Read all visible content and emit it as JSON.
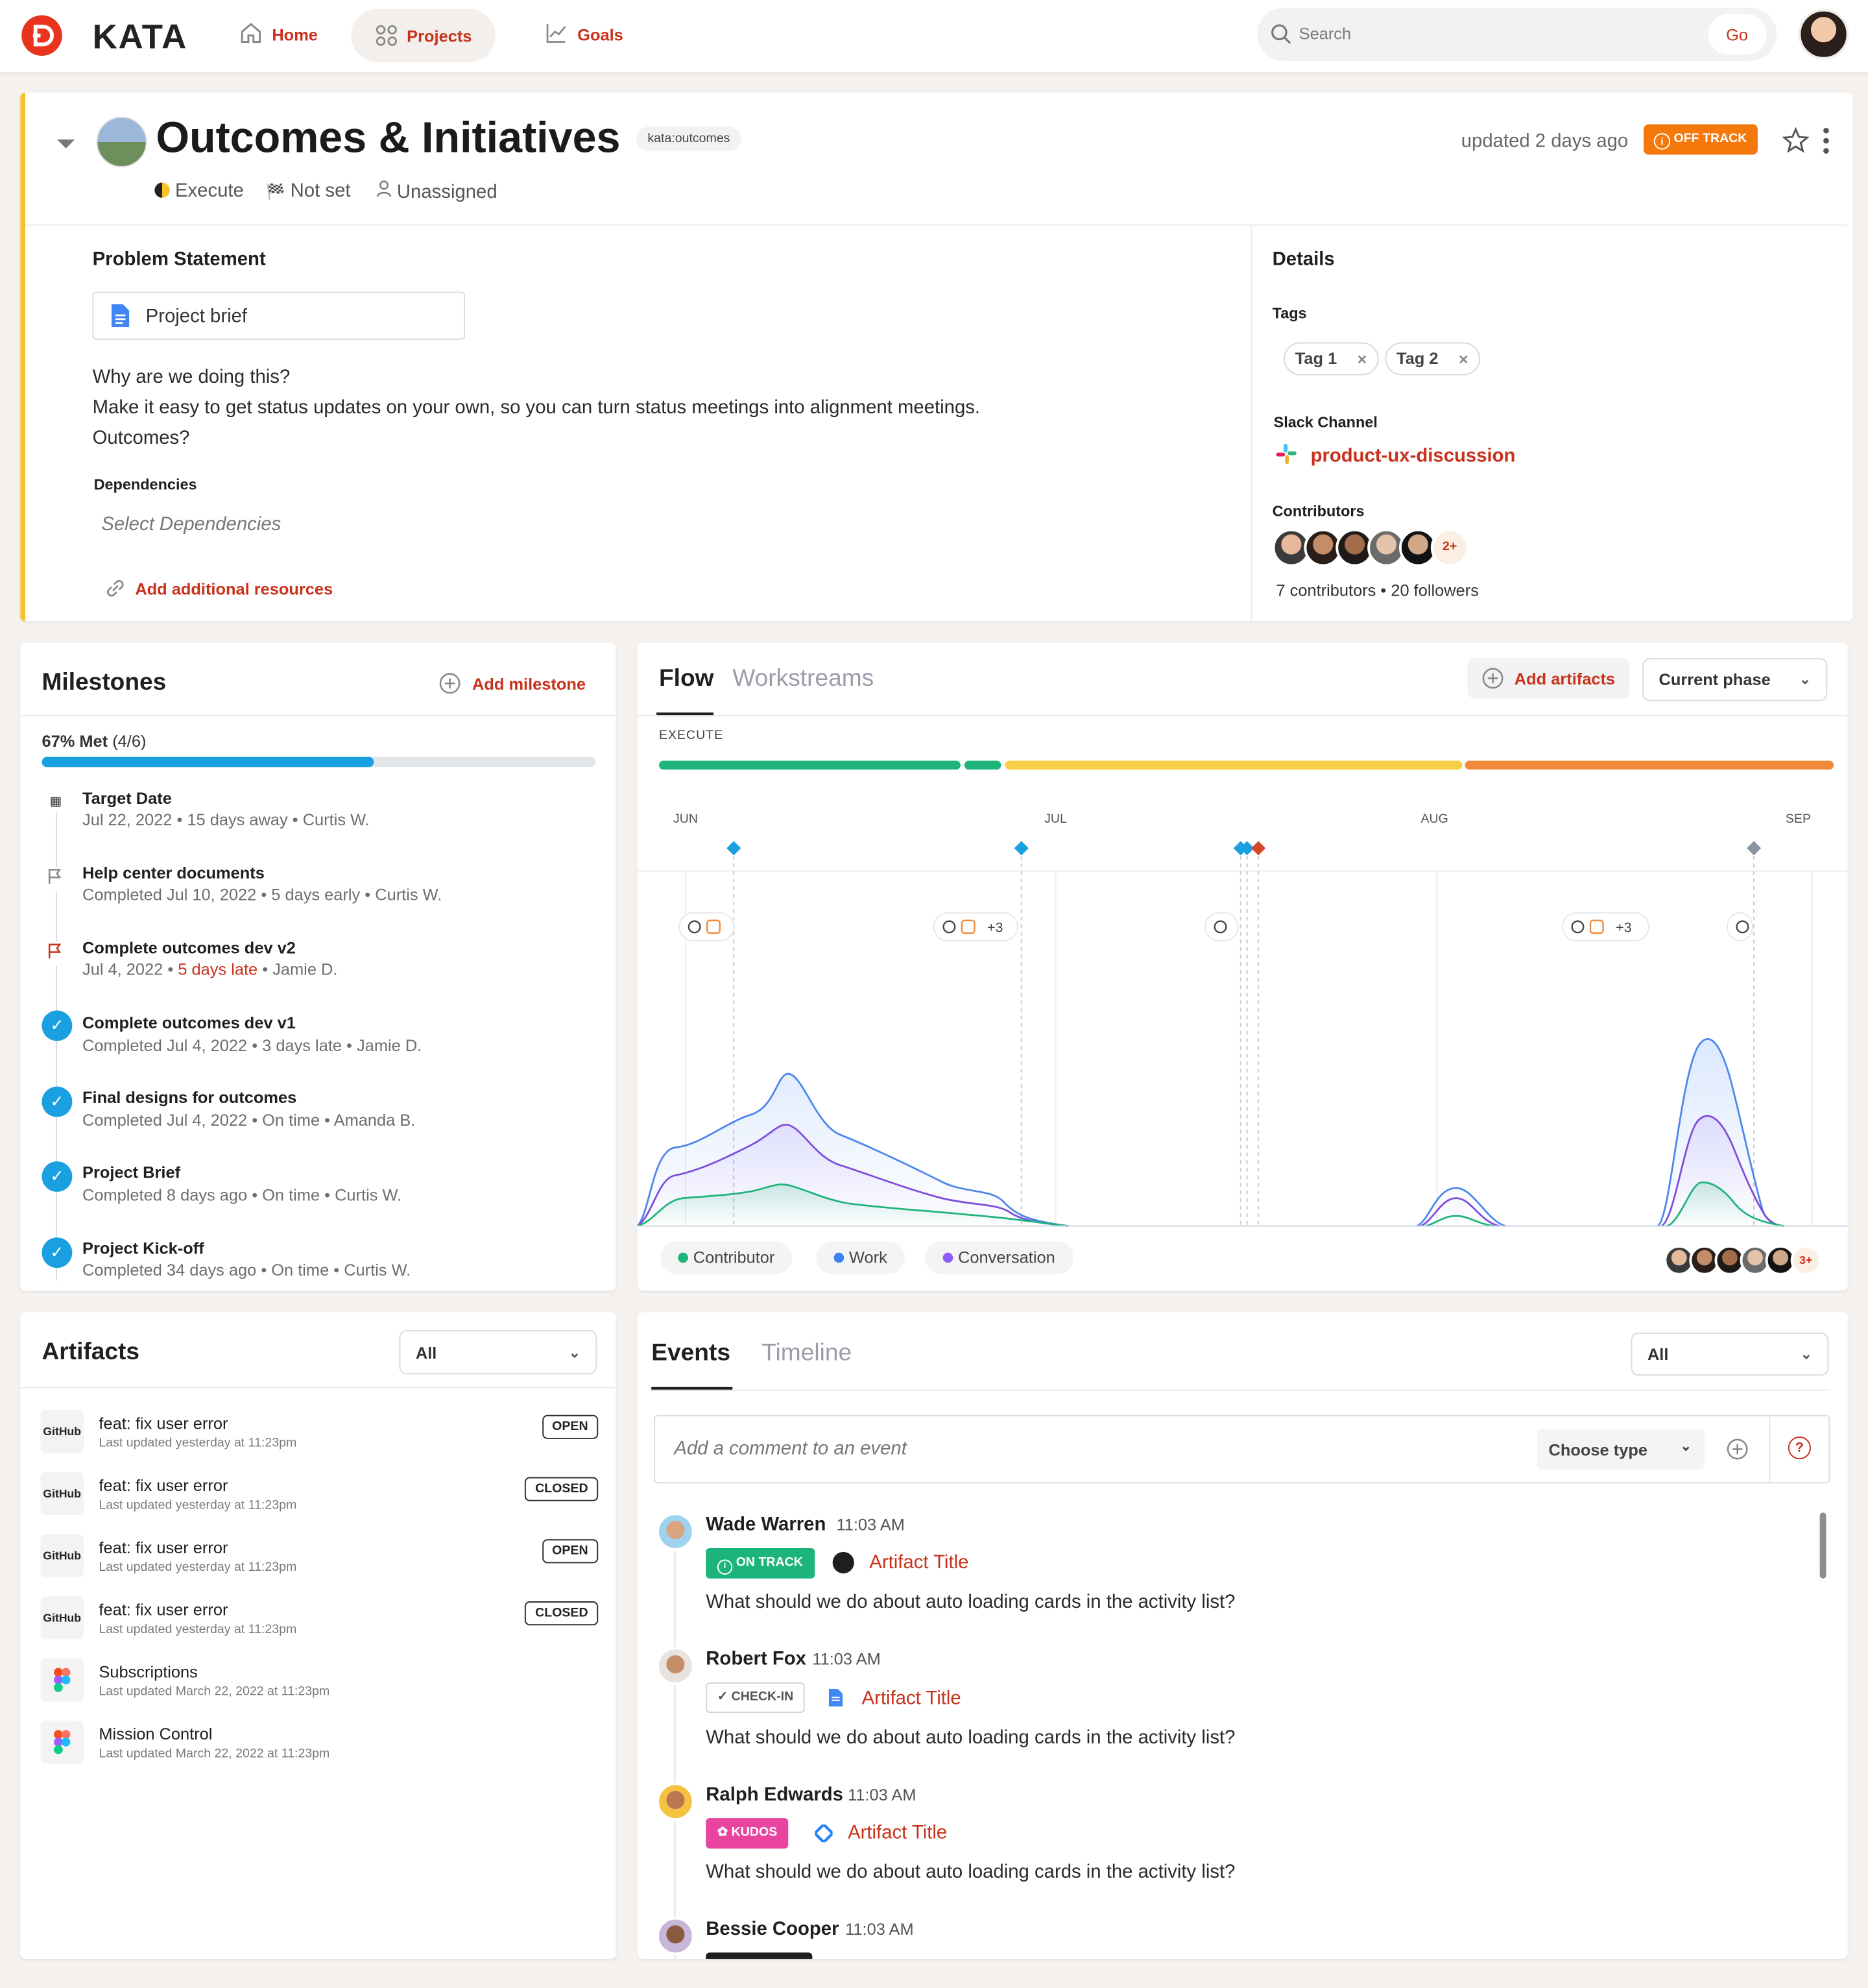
{
  "nav": {
    "brand": "KATA",
    "items": [
      {
        "label": "Home"
      },
      {
        "label": "Projects"
      },
      {
        "label": "Goals"
      }
    ],
    "search_placeholder": "Search",
    "go_label": "Go"
  },
  "project": {
    "title": "Outcomes & Initiatives",
    "tag": "kata:outcomes",
    "phase": "Execute",
    "target": "Not set",
    "owner": "Unassigned",
    "updated": "updated 2 days ago",
    "status": "OFF TRACK",
    "status_color": "#f5780b"
  },
  "problem": {
    "heading": "Problem Statement",
    "brief_label": "Project brief",
    "line1": "Why are we doing this?",
    "line2": "Make it easy to get status updates on your own, so you can turn status meetings into alignment meetings.",
    "line3": "Outcomes?",
    "dependencies_heading": "Dependencies",
    "dependencies_placeholder": "Select Dependencies",
    "add_resources": "Add additional resources"
  },
  "details": {
    "heading": "Details",
    "tags_heading": "Tags",
    "tags": [
      "Tag 1",
      "Tag 2"
    ],
    "slack_heading": "Slack Channel",
    "slack_channel": "product-ux-discussion",
    "contributors_heading": "Contributors",
    "contributors_more": "2+",
    "contributors_summary": "7 contributors • 20 followers"
  },
  "milestones": {
    "heading": "Milestones",
    "add_label": "Add milestone",
    "met_label": "67% Met",
    "met_count": "(4/6)",
    "progress": 0.6,
    "items": [
      {
        "title": "Target Date",
        "sub": "Jul 22, 2022 • 15 days away • Curtis W.",
        "icon": "checkered-flag-icon"
      },
      {
        "title": "Help center documents",
        "sub": "Completed Jul 10, 2022 • 5 days early • Curtis W.",
        "icon": "flag-icon"
      },
      {
        "title": "Complete outcomes dev v2",
        "sub_a": "Jul 4, 2022 •",
        "sub_late": "5 days late",
        "sub_b": "• Jamie D.",
        "icon": "red-flag-icon"
      },
      {
        "title": "Complete outcomes dev v1",
        "sub": "Completed Jul 4, 2022 • 3 days late • Jamie D.",
        "icon": "check-icon"
      },
      {
        "title": "Final designs for outcomes",
        "sub": "Completed Jul 4, 2022 • On time • Amanda B.",
        "icon": "check-icon"
      },
      {
        "title": "Project Brief",
        "sub": "Completed 8 days ago • On time • Curtis W.",
        "icon": "check-icon"
      },
      {
        "title": "Project Kick-off",
        "sub": "Completed 34 days ago • On time • Curtis W.",
        "icon": "check-icon"
      }
    ]
  },
  "flow": {
    "tabs": [
      "Flow",
      "Workstreams"
    ],
    "add_artifacts": "Add artifacts",
    "phase_select": "Current phase",
    "phase_label": "EXECUTE",
    "months": [
      "JUN",
      "JUL",
      "AUG",
      "SEP"
    ],
    "marker_more": "+3",
    "legend": [
      "Contributor",
      "Work",
      "Conversation"
    ],
    "legend_colors": [
      "#1fb47a",
      "#3b82f6",
      "#8b5cf6"
    ],
    "avatars_more": "3+"
  },
  "artifacts": {
    "heading": "Artifacts",
    "filter": "All",
    "items": [
      {
        "source": "GitHub",
        "title": "feat: fix user error",
        "updated": "Last updated yesterday at 11:23pm",
        "state": "OPEN"
      },
      {
        "source": "GitHub",
        "title": "feat: fix user error",
        "updated": "Last updated yesterday at 11:23pm",
        "state": "CLOSED"
      },
      {
        "source": "GitHub",
        "title": "feat: fix user error",
        "updated": "Last updated yesterday at 11:23pm",
        "state": "OPEN"
      },
      {
        "source": "GitHub",
        "title": "feat: fix user error",
        "updated": "Last updated yesterday at 11:23pm",
        "state": "CLOSED"
      },
      {
        "source": "Figma",
        "title": "Subscriptions",
        "updated": "Last updated March 22, 2022 at 11:23pm",
        "state": ""
      },
      {
        "source": "Figma",
        "title": "Mission Control",
        "updated": "Last updated March 22, 2022 at 11:23pm",
        "state": ""
      }
    ]
  },
  "events": {
    "tabs": [
      "Events",
      "Timeline"
    ],
    "filter": "All",
    "comment_placeholder": "Add a comment to an event",
    "choose_type": "Choose type",
    "items": [
      {
        "name": "Wade Warren",
        "time": "11:03 AM",
        "badge": "ON TRACK",
        "artifact": "Artifact Title",
        "text": "What should we do about auto loading cards in the activity list?"
      },
      {
        "name": "Robert Fox",
        "time": "11:03 AM",
        "badge": "CHECK-IN",
        "artifact": "Artifact Title",
        "text": "What should we do about auto loading cards in the activity list?"
      },
      {
        "name": "Ralph Edwards",
        "time": "11:03 AM",
        "badge": "KUDOS",
        "artifact": "Artifact Title",
        "text": "What should we do about auto loading cards in the activity list?"
      },
      {
        "name": "Bessie Cooper",
        "time": "11:03 AM"
      }
    ]
  }
}
